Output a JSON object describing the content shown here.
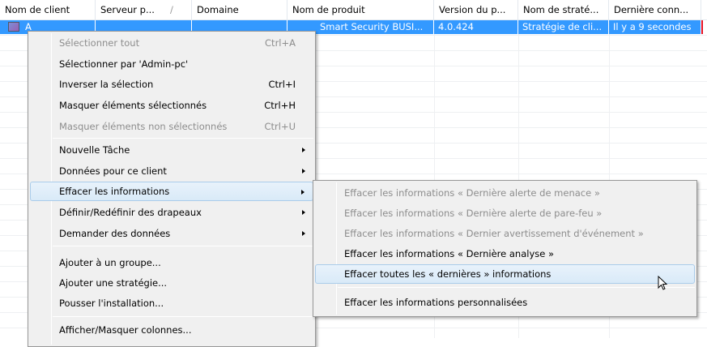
{
  "columns": [
    "Nom de client",
    "Serveur p...",
    "Domaine",
    "Nom de produit",
    "Version du p...",
    "Nom de straté...",
    "Dernière conn..."
  ],
  "sort_indicator": "/",
  "row": {
    "client": "A",
    "product": "Smart Security BUSI...",
    "version": "4.0.424",
    "policy": "Stratégie de cli...",
    "last_conn": "Il y a 9 secondes"
  },
  "menu": {
    "select_all": "Sélectionner tout",
    "select_all_sc": "Ctrl+A",
    "select_by": "Sélectionner par 'Admin-pc'",
    "invert": "Inverser la sélection",
    "invert_sc": "Ctrl+I",
    "hide_sel": "Masquer éléments sélectionnés",
    "hide_sel_sc": "Ctrl+H",
    "hide_unsel": "Masquer éléments non sélectionnés",
    "hide_unsel_sc": "Ctrl+U",
    "new_task": "Nouvelle Tâche",
    "client_data": "Données pour ce client",
    "clear_info": "Effacer les informations",
    "flags": "Définir/Redéfinir des drapeaux",
    "request": "Demander des données",
    "add_group": "Ajouter à un groupe...",
    "add_policy": "Ajouter une stratégie...",
    "push": "Pousser l'installation...",
    "columns": "Afficher/Masquer colonnes..."
  },
  "submenu": {
    "threat": "Effacer les informations « Dernière alerte de menace »",
    "firewall": "Effacer les informations « Dernière alerte de pare-feu »",
    "event": "Effacer les informations « Dernier avertissement d'événement »",
    "scan": "Effacer les informations « Dernière analyse »",
    "all": "Effacer toutes les « dernières » informations",
    "custom": "Effacer les informations personnalisées"
  }
}
